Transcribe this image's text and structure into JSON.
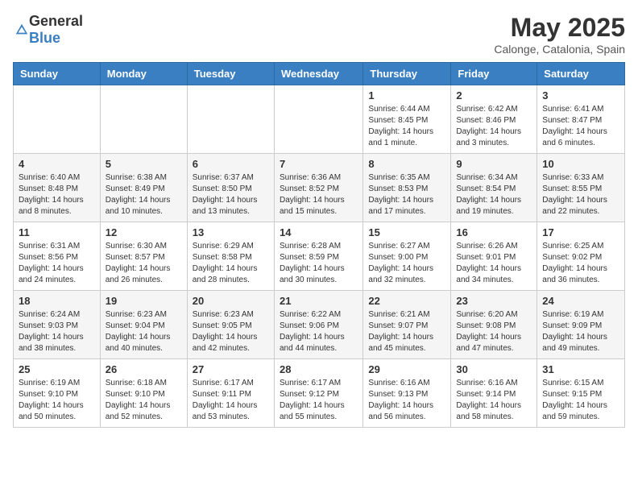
{
  "header": {
    "logo_general": "General",
    "logo_blue": "Blue",
    "month_year": "May 2025",
    "location": "Calonge, Catalonia, Spain"
  },
  "days_of_week": [
    "Sunday",
    "Monday",
    "Tuesday",
    "Wednesday",
    "Thursday",
    "Friday",
    "Saturday"
  ],
  "weeks": [
    [
      {
        "day": "",
        "content": ""
      },
      {
        "day": "",
        "content": ""
      },
      {
        "day": "",
        "content": ""
      },
      {
        "day": "",
        "content": ""
      },
      {
        "day": "1",
        "content": "Sunrise: 6:44 AM\nSunset: 8:45 PM\nDaylight: 14 hours and 1 minute."
      },
      {
        "day": "2",
        "content": "Sunrise: 6:42 AM\nSunset: 8:46 PM\nDaylight: 14 hours and 3 minutes."
      },
      {
        "day": "3",
        "content": "Sunrise: 6:41 AM\nSunset: 8:47 PM\nDaylight: 14 hours and 6 minutes."
      }
    ],
    [
      {
        "day": "4",
        "content": "Sunrise: 6:40 AM\nSunset: 8:48 PM\nDaylight: 14 hours and 8 minutes."
      },
      {
        "day": "5",
        "content": "Sunrise: 6:38 AM\nSunset: 8:49 PM\nDaylight: 14 hours and 10 minutes."
      },
      {
        "day": "6",
        "content": "Sunrise: 6:37 AM\nSunset: 8:50 PM\nDaylight: 14 hours and 13 minutes."
      },
      {
        "day": "7",
        "content": "Sunrise: 6:36 AM\nSunset: 8:52 PM\nDaylight: 14 hours and 15 minutes."
      },
      {
        "day": "8",
        "content": "Sunrise: 6:35 AM\nSunset: 8:53 PM\nDaylight: 14 hours and 17 minutes."
      },
      {
        "day": "9",
        "content": "Sunrise: 6:34 AM\nSunset: 8:54 PM\nDaylight: 14 hours and 19 minutes."
      },
      {
        "day": "10",
        "content": "Sunrise: 6:33 AM\nSunset: 8:55 PM\nDaylight: 14 hours and 22 minutes."
      }
    ],
    [
      {
        "day": "11",
        "content": "Sunrise: 6:31 AM\nSunset: 8:56 PM\nDaylight: 14 hours and 24 minutes."
      },
      {
        "day": "12",
        "content": "Sunrise: 6:30 AM\nSunset: 8:57 PM\nDaylight: 14 hours and 26 minutes."
      },
      {
        "day": "13",
        "content": "Sunrise: 6:29 AM\nSunset: 8:58 PM\nDaylight: 14 hours and 28 minutes."
      },
      {
        "day": "14",
        "content": "Sunrise: 6:28 AM\nSunset: 8:59 PM\nDaylight: 14 hours and 30 minutes."
      },
      {
        "day": "15",
        "content": "Sunrise: 6:27 AM\nSunset: 9:00 PM\nDaylight: 14 hours and 32 minutes."
      },
      {
        "day": "16",
        "content": "Sunrise: 6:26 AM\nSunset: 9:01 PM\nDaylight: 14 hours and 34 minutes."
      },
      {
        "day": "17",
        "content": "Sunrise: 6:25 AM\nSunset: 9:02 PM\nDaylight: 14 hours and 36 minutes."
      }
    ],
    [
      {
        "day": "18",
        "content": "Sunrise: 6:24 AM\nSunset: 9:03 PM\nDaylight: 14 hours and 38 minutes."
      },
      {
        "day": "19",
        "content": "Sunrise: 6:23 AM\nSunset: 9:04 PM\nDaylight: 14 hours and 40 minutes."
      },
      {
        "day": "20",
        "content": "Sunrise: 6:23 AM\nSunset: 9:05 PM\nDaylight: 14 hours and 42 minutes."
      },
      {
        "day": "21",
        "content": "Sunrise: 6:22 AM\nSunset: 9:06 PM\nDaylight: 14 hours and 44 minutes."
      },
      {
        "day": "22",
        "content": "Sunrise: 6:21 AM\nSunset: 9:07 PM\nDaylight: 14 hours and 45 minutes."
      },
      {
        "day": "23",
        "content": "Sunrise: 6:20 AM\nSunset: 9:08 PM\nDaylight: 14 hours and 47 minutes."
      },
      {
        "day": "24",
        "content": "Sunrise: 6:19 AM\nSunset: 9:09 PM\nDaylight: 14 hours and 49 minutes."
      }
    ],
    [
      {
        "day": "25",
        "content": "Sunrise: 6:19 AM\nSunset: 9:10 PM\nDaylight: 14 hours and 50 minutes."
      },
      {
        "day": "26",
        "content": "Sunrise: 6:18 AM\nSunset: 9:10 PM\nDaylight: 14 hours and 52 minutes."
      },
      {
        "day": "27",
        "content": "Sunrise: 6:17 AM\nSunset: 9:11 PM\nDaylight: 14 hours and 53 minutes."
      },
      {
        "day": "28",
        "content": "Sunrise: 6:17 AM\nSunset: 9:12 PM\nDaylight: 14 hours and 55 minutes."
      },
      {
        "day": "29",
        "content": "Sunrise: 6:16 AM\nSunset: 9:13 PM\nDaylight: 14 hours and 56 minutes."
      },
      {
        "day": "30",
        "content": "Sunrise: 6:16 AM\nSunset: 9:14 PM\nDaylight: 14 hours and 58 minutes."
      },
      {
        "day": "31",
        "content": "Sunrise: 6:15 AM\nSunset: 9:15 PM\nDaylight: 14 hours and 59 minutes."
      }
    ]
  ]
}
